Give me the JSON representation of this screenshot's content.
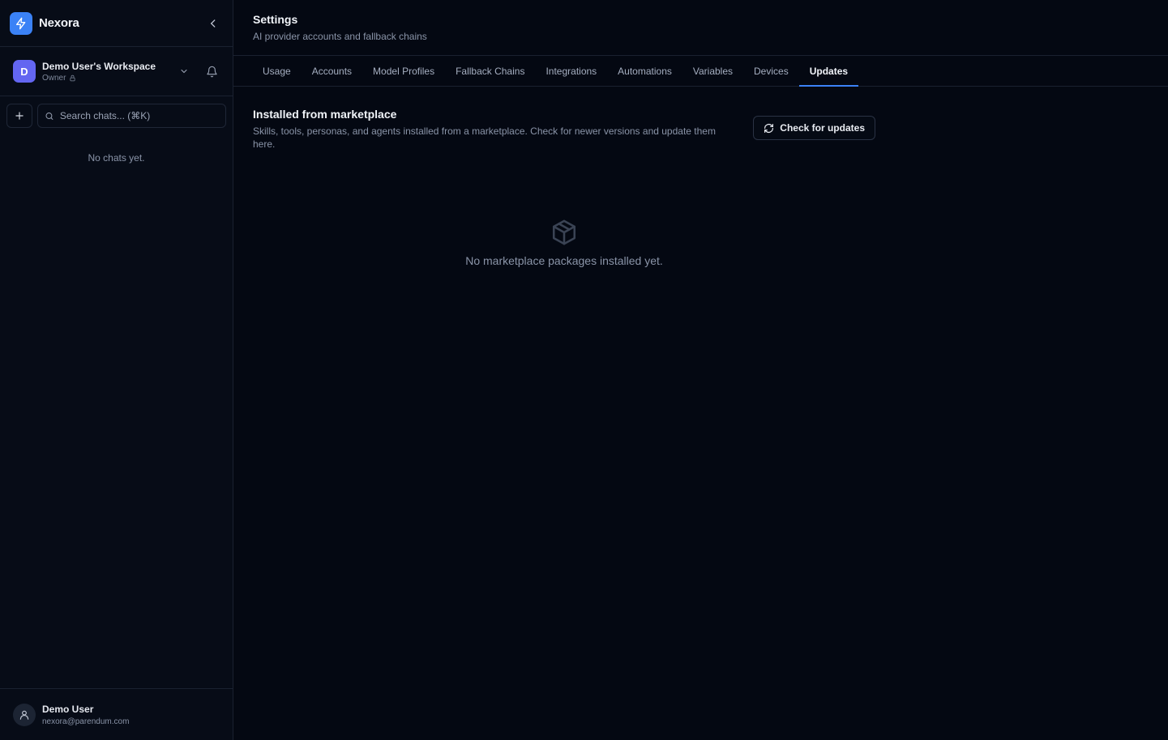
{
  "brand": {
    "name": "Nexora"
  },
  "workspace": {
    "initial": "D",
    "name": "Demo User's Workspace",
    "role": "Owner"
  },
  "search": {
    "placeholder": "Search chats... (⌘K)"
  },
  "chats": {
    "empty_text": "No chats yet."
  },
  "user": {
    "name": "Demo User",
    "email": "nexora@parendum.com"
  },
  "header": {
    "title": "Settings",
    "subtitle": "AI provider accounts and fallback chains"
  },
  "tabs": [
    {
      "label": "Usage"
    },
    {
      "label": "Accounts"
    },
    {
      "label": "Model Profiles"
    },
    {
      "label": "Fallback Chains"
    },
    {
      "label": "Integrations"
    },
    {
      "label": "Automations"
    },
    {
      "label": "Variables"
    },
    {
      "label": "Devices"
    },
    {
      "label": "Updates",
      "active": true
    }
  ],
  "section": {
    "title": "Installed from marketplace",
    "description": "Skills, tools, personas, and agents installed from a marketplace. Check for newer versions and update them here.",
    "check_button": "Check for updates"
  },
  "empty_state": {
    "text": "No marketplace packages installed yet.",
    "icon": "package-icon"
  },
  "colors": {
    "accent": "#3b82f6",
    "workspace_avatar": "#6366f1",
    "background": "#040812",
    "sidebar": "#070c17"
  }
}
